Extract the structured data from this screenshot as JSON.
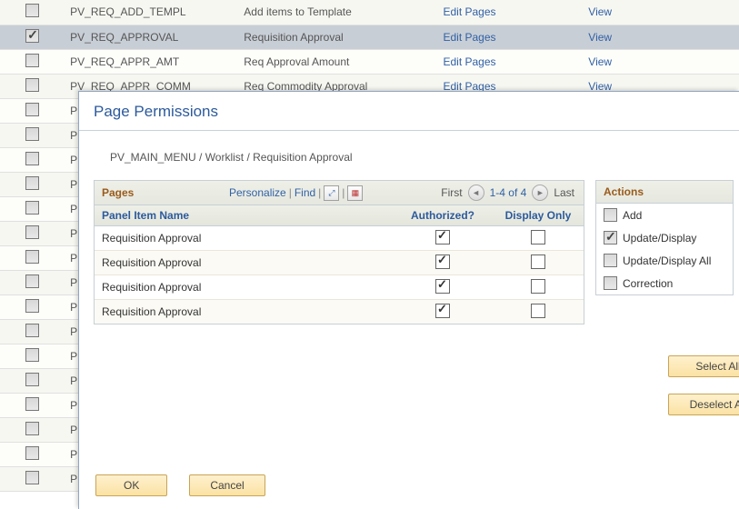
{
  "bg_rows": [
    {
      "name": "PV_REQ_ADD_TEMPL",
      "desc": "Add items to Template",
      "edit": "Edit Pages",
      "view": "View",
      "checked": false,
      "cls": "alt1"
    },
    {
      "name": "PV_REQ_APPROVAL",
      "desc": "Requisition Approval",
      "edit": "Edit Pages",
      "view": "View",
      "checked": true,
      "cls": "sel"
    },
    {
      "name": "PV_REQ_APPR_AMT",
      "desc": "Req Approval Amount",
      "edit": "Edit Pages",
      "view": "View",
      "checked": false,
      "cls": "alt2"
    },
    {
      "name": "PV_REQ_APPR_COMM",
      "desc": "Req Commodity Approval",
      "edit": "Edit Pages",
      "view": "View",
      "checked": false,
      "cls": "alt1"
    },
    {
      "name": "P",
      "desc": "",
      "edit": "",
      "view": "",
      "checked": false,
      "cls": "alt2"
    },
    {
      "name": "P",
      "desc": "",
      "edit": "",
      "view": "",
      "checked": false,
      "cls": "alt1"
    },
    {
      "name": "P",
      "desc": "",
      "edit": "",
      "view": "",
      "checked": false,
      "cls": "alt2"
    },
    {
      "name": "P",
      "desc": "",
      "edit": "",
      "view": "",
      "checked": false,
      "cls": "alt1"
    },
    {
      "name": "P",
      "desc": "",
      "edit": "",
      "view": "",
      "checked": false,
      "cls": "alt2"
    },
    {
      "name": "P",
      "desc": "",
      "edit": "",
      "view": "",
      "checked": false,
      "cls": "alt1"
    },
    {
      "name": "P",
      "desc": "",
      "edit": "",
      "view": "",
      "checked": false,
      "cls": "alt2"
    },
    {
      "name": "P",
      "desc": "",
      "edit": "",
      "view": "",
      "checked": false,
      "cls": "alt1"
    },
    {
      "name": "P",
      "desc": "",
      "edit": "",
      "view": "",
      "checked": false,
      "cls": "alt2"
    },
    {
      "name": "P",
      "desc": "",
      "edit": "",
      "view": "",
      "checked": false,
      "cls": "alt1"
    },
    {
      "name": "P",
      "desc": "",
      "edit": "",
      "view": "",
      "checked": false,
      "cls": "alt2"
    },
    {
      "name": "P",
      "desc": "",
      "edit": "",
      "view": "",
      "checked": false,
      "cls": "alt1"
    },
    {
      "name": "P",
      "desc": "",
      "edit": "",
      "view": "",
      "checked": false,
      "cls": "alt2"
    },
    {
      "name": "P",
      "desc": "",
      "edit": "",
      "view": "",
      "checked": false,
      "cls": "alt1"
    },
    {
      "name": "P",
      "desc": "",
      "edit": "",
      "view": "",
      "checked": false,
      "cls": "alt2"
    },
    {
      "name": "P",
      "desc": "",
      "edit": "",
      "view": "",
      "checked": false,
      "cls": "alt1"
    }
  ],
  "modal": {
    "title": "Page Permissions",
    "breadcrumb": "PV_MAIN_MENU / Worklist / Requisition Approval",
    "grid": {
      "title": "Pages",
      "tools": {
        "personalize": "Personalize",
        "find": "Find"
      },
      "nav": {
        "first": "First",
        "range": "1-4 of 4",
        "last": "Last"
      },
      "cols": {
        "c1": "Panel Item Name",
        "c2": "Authorized?",
        "c3": "Display Only"
      },
      "rows": [
        {
          "name": "Requisition Approval",
          "auth": true,
          "disp": false
        },
        {
          "name": "Requisition Approval",
          "auth": true,
          "disp": false
        },
        {
          "name": "Requisition Approval",
          "auth": true,
          "disp": false
        },
        {
          "name": "Requisition Approval",
          "auth": true,
          "disp": false
        }
      ]
    },
    "actions": {
      "title": "Actions",
      "items": [
        {
          "label": "Add",
          "checked": false
        },
        {
          "label": "Update/Display",
          "checked": true
        },
        {
          "label": "Update/Display All",
          "checked": false
        },
        {
          "label": "Correction",
          "checked": false
        }
      ],
      "selectAll": "Select All",
      "deselectAll": "Deselect All"
    },
    "buttons": {
      "ok": "OK",
      "cancel": "Cancel"
    }
  }
}
